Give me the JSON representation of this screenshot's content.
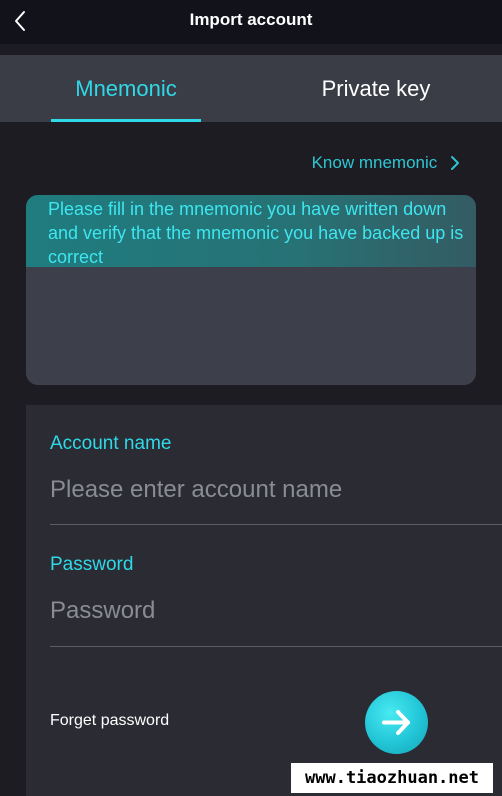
{
  "header": {
    "title": "Import account",
    "back_icon": "chevron-left-icon"
  },
  "tabs": [
    {
      "label": "Mnemonic",
      "active": true
    },
    {
      "label": "Private key",
      "active": false
    }
  ],
  "know_link": {
    "label": "Know mnemonic",
    "icon": "chevron-right-icon"
  },
  "mnemonic": {
    "hint": "Please fill in the mnemonic you have written down and verify that the mnemonic you have backed up is correct",
    "value": ""
  },
  "account_name": {
    "label": "Account name",
    "placeholder": "Please enter account name",
    "value": ""
  },
  "password": {
    "label": "Password",
    "placeholder": "Password",
    "value": ""
  },
  "forget_password": {
    "label": "Forget password"
  },
  "submit": {
    "icon": "arrow-right-icon"
  },
  "watermark": {
    "text": "www.tiaozhuan.net"
  },
  "colors": {
    "accent": "#2fd9e8",
    "background": "#1c1c22",
    "header": "#12131a",
    "tab_bar": "#3a3c46",
    "input_box": "#3d3f4b"
  }
}
